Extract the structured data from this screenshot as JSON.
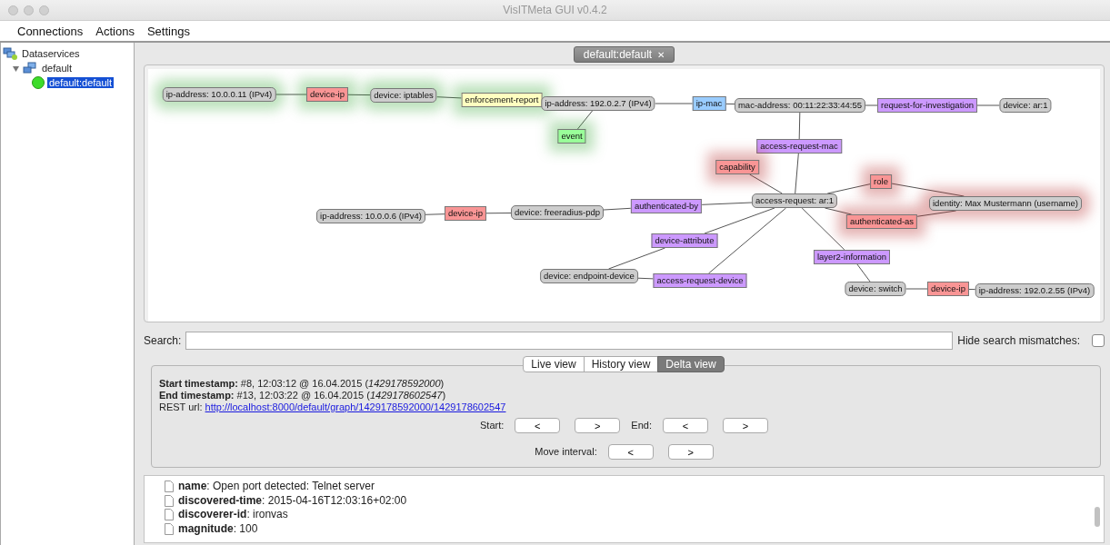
{
  "window": {
    "title": "VisITMeta GUI v0.4.2"
  },
  "menu": [
    {
      "label": "Connections"
    },
    {
      "label": "Actions"
    },
    {
      "label": "Settings"
    }
  ],
  "tree": {
    "label": "Dataservices",
    "selected": false,
    "children": [
      {
        "label": "default",
        "selected": false,
        "expanded": true,
        "children": [
          {
            "label": "default:default",
            "selected": true
          }
        ]
      }
    ]
  },
  "tab": {
    "label": "default:default",
    "close": "✕"
  },
  "graph": {
    "nodes": [
      {
        "label": "ip-address: 10.0.0.11 (IPv4)",
        "kind": "identifier",
        "added": true,
        "removed": false
      },
      {
        "label": "device-ip",
        "kind": "metadata",
        "color": "#f99595",
        "added": true,
        "removed": false
      },
      {
        "label": "device: iptables",
        "kind": "identifier",
        "added": true,
        "removed": false
      },
      {
        "label": "enforcement-report",
        "kind": "metadata",
        "color": "#ffffc0",
        "added": true,
        "removed": false
      },
      {
        "label": "ip-address: 192.0.2.7 (IPv4)",
        "kind": "identifier",
        "added": false,
        "removed": false
      },
      {
        "label": "event",
        "kind": "metadata",
        "color": "#99ff99",
        "added": true,
        "removed": false
      },
      {
        "label": "ip-mac",
        "kind": "metadata",
        "color": "#99ccff",
        "added": false,
        "removed": false
      },
      {
        "label": "mac-address: 00:11:22:33:44:55",
        "kind": "identifier",
        "added": false,
        "removed": false
      },
      {
        "label": "request-for-investigation",
        "kind": "metadata",
        "color": "#cc99ff",
        "added": false,
        "removed": false
      },
      {
        "label": "device: ar:1",
        "kind": "identifier",
        "added": false,
        "removed": false
      },
      {
        "label": "access-request-mac",
        "kind": "metadata",
        "color": "#cc99ff",
        "added": false,
        "removed": false
      },
      {
        "label": "capability",
        "kind": "metadata",
        "color": "#f99595",
        "added": false,
        "removed": true
      },
      {
        "label": "role",
        "kind": "metadata",
        "color": "#f99595",
        "added": false,
        "removed": true
      },
      {
        "label": "ip-address: 10.0.0.6 (IPv4)",
        "kind": "identifier",
        "added": false,
        "removed": false
      },
      {
        "label": "device-ip",
        "kind": "metadata",
        "color": "#f99595",
        "added": false,
        "removed": false
      },
      {
        "label": "device: freeradius-pdp",
        "kind": "identifier",
        "added": false,
        "removed": false
      },
      {
        "label": "authenticated-by",
        "kind": "metadata",
        "color": "#cc99ff",
        "added": false,
        "removed": false
      },
      {
        "label": "access-request: ar:1",
        "kind": "identifier",
        "added": false,
        "removed": false
      },
      {
        "label": "identity: Max Mustermann (username)",
        "kind": "identifier",
        "added": false,
        "removed": true
      },
      {
        "label": "authenticated-as",
        "kind": "metadata",
        "color": "#f99595",
        "added": false,
        "removed": true
      },
      {
        "label": "device-attribute",
        "kind": "metadata",
        "color": "#cc99ff",
        "added": false,
        "removed": false
      },
      {
        "label": "layer2-information",
        "kind": "metadata",
        "color": "#cc99ff",
        "added": false,
        "removed": false
      },
      {
        "label": "device: endpoint-device",
        "kind": "identifier",
        "added": false,
        "removed": false
      },
      {
        "label": "access-request-device",
        "kind": "metadata",
        "color": "#cc99ff",
        "added": false,
        "removed": false
      },
      {
        "label": "device: switch",
        "kind": "identifier",
        "added": false,
        "removed": false
      },
      {
        "label": "device-ip",
        "kind": "metadata",
        "color": "#f99595",
        "added": false,
        "removed": false
      },
      {
        "label": "ip-address: 192.0.2.55 (IPv4)",
        "kind": "identifier",
        "added": false,
        "removed": false
      }
    ]
  },
  "search": {
    "label": "Search:",
    "hide_label": "Hide search mismatches:",
    "hide_checked": false
  },
  "view_tabs": [
    {
      "label": "Live view",
      "selected": false
    },
    {
      "label": "History view",
      "selected": false
    },
    {
      "label": "Delta view",
      "selected": true
    }
  ],
  "delta": {
    "start": "**Start timestamp:** #8, 12:03:12 @ 16.04.2015 (*1429178592000*)",
    "end": "**End timestamp:** #13, 12:03:22 @ 16.04.2015 (*1429178602547*)",
    "rest_label": "REST url:",
    "rest_url": "http://localhost:8000/default/graph/1429178592000/1429178602547",
    "start_label": "Start:",
    "start_prev": "<",
    "start_next": ">",
    "end_label": "End:",
    "end_prev": "<",
    "end_next": ">",
    "move_label": "Move interval:",
    "move_prev": "<",
    "move_next": ">"
  },
  "details": [
    {
      "text": "**name**: Open port detected: Telnet server"
    },
    {
      "text": "**discovered-time**: 2015-04-16T12:03:16+02:00"
    },
    {
      "text": "**discoverer-id**: ironvas"
    },
    {
      "text": "**magnitude**: 100"
    }
  ]
}
